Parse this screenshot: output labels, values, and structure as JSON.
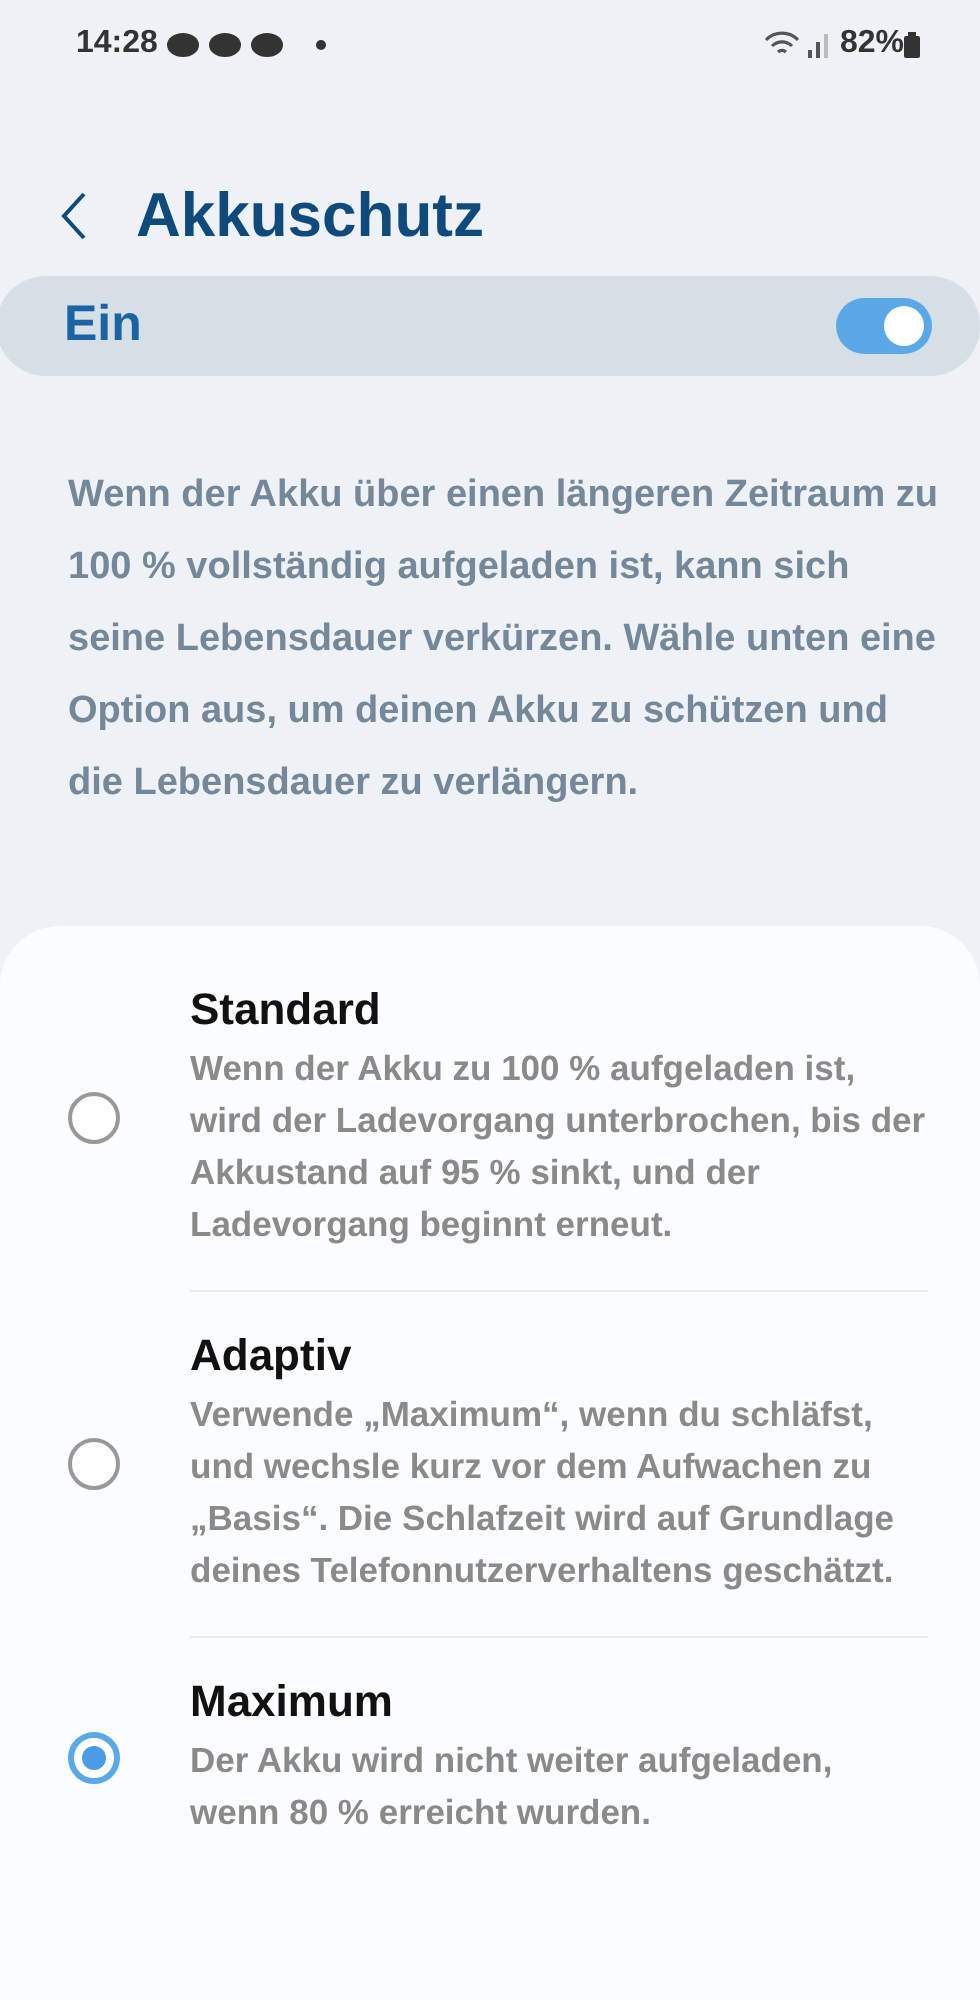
{
  "status_bar": {
    "time": "14:28",
    "battery": "82%"
  },
  "header": {
    "title": "Akkuschutz"
  },
  "master_switch": {
    "label": "Ein",
    "on": true
  },
  "description": "Wenn der Akku über einen längeren Zeitraum zu 100 % vollständig aufgeladen ist, kann sich seine Lebensdauer verkürzen. Wähle unten eine Option aus, um deinen Akku zu schützen und die Lebensdauer zu verlängern.",
  "options": [
    {
      "title": "Standard",
      "description": "Wenn der Akku zu 100 % aufgeladen ist, wird der Ladevorgang unterbrochen, bis der Akkustand auf 95 % sinkt, und der Ladevorgang beginnt erneut.",
      "selected": false
    },
    {
      "title": "Adaptiv",
      "description": "Verwende „Maximum“, wenn du schläfst, und wechsle kurz vor dem Aufwachen zu „Basis“. Die Schlafzeit wird auf Grundlage deines Telefonnutzerverhaltens geschätzt.",
      "selected": false
    },
    {
      "title": "Maximum",
      "description": "Der Akku wird nicht weiter aufgeladen, wenn 80 % erreicht wurden.",
      "selected": true
    }
  ]
}
